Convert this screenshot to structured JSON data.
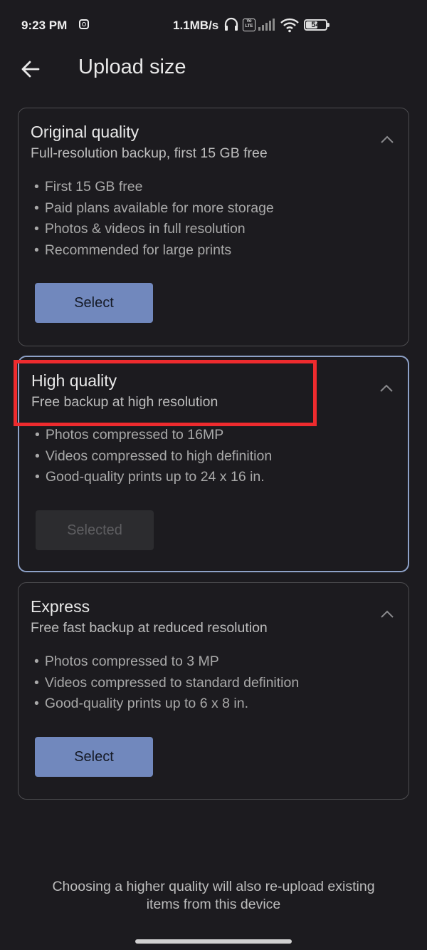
{
  "status_bar": {
    "time": "9:23 PM",
    "net_speed": "1.1MB/s",
    "volte_label": "Vo LTE",
    "battery_level": "54",
    "icons": [
      "instagram-icon",
      "headset-icon",
      "volte-icon",
      "signal-icon",
      "wifi-icon",
      "battery-icon"
    ]
  },
  "header": {
    "back_icon": "arrow-left-icon",
    "title": "Upload size"
  },
  "options": [
    {
      "title": "Original quality",
      "subtitle": "Full-resolution backup, first 15 GB free",
      "bullets": [
        "First 15 GB free",
        "Paid plans available for more storage",
        "Photos & videos in full resolution",
        "Recommended for large prints"
      ],
      "button_label": "Select",
      "selected": false
    },
    {
      "title": "High quality",
      "subtitle": "Free backup at high resolution",
      "bullets": [
        "Photos compressed to 16MP",
        "Videos compressed to high definition",
        "Good-quality prints up to 24 x 16 in."
      ],
      "button_label": "Selected",
      "selected": true
    },
    {
      "title": "Express",
      "subtitle": "Free fast backup at reduced resolution",
      "bullets": [
        "Photos compressed to 3 MP",
        "Videos compressed to standard definition",
        "Good-quality prints up to 6 x 8 in."
      ],
      "button_label": "Select",
      "selected": false
    }
  ],
  "footer": {
    "note_line1": "Choosing a higher quality will also re-upload existing",
    "note_line2": "items from this device"
  },
  "colors": {
    "background": "#1c1b1f",
    "accent_button": "#7188bd",
    "selected_border": "#8ea2c8",
    "highlight_annotation": "#ee2b2e"
  }
}
